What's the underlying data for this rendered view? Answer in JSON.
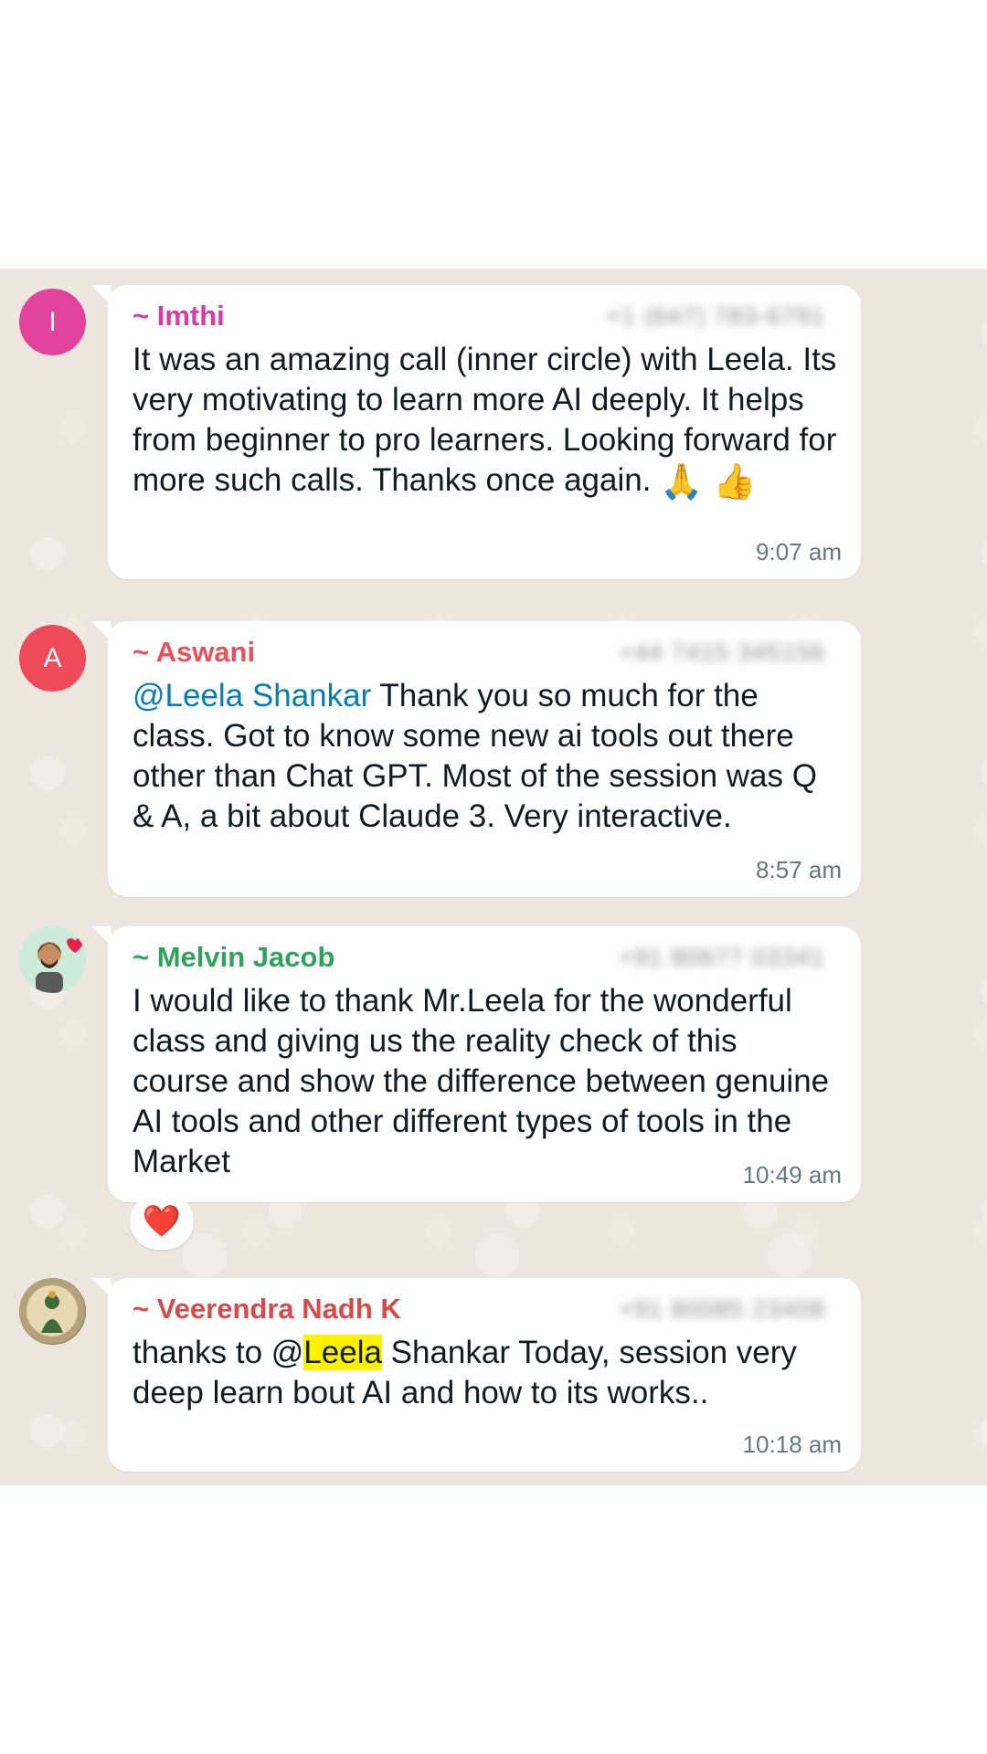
{
  "messages": [
    {
      "avatar_letter": "I",
      "avatar_color": "#e0429c",
      "sender": "~ Imthi",
      "sender_color": "#d63aa6",
      "phone": "+1 (647) 783-6791",
      "text": "It was an amazing call (inner circle) with Leela. Its very motivating to learn more AI deeply. It helps from beginner to pro learners. Looking forward for more such calls. Thanks once again.",
      "emojis": "🙏 👍",
      "time": "9:07 am"
    },
    {
      "avatar_letter": "A",
      "avatar_color": "#ef4a5a",
      "sender": "~ Aswani",
      "sender_color": "#e8505b",
      "phone": "+44 7415 345156",
      "mention": "@Leela Shankar",
      "text": " Thank you so much for the class. Got to know some new ai tools out there other than Chat GPT. Most of the session was Q & A, a bit about Claude 3. Very interactive.",
      "time": "8:57 am"
    },
    {
      "avatar_icon": "memoji-avatar-icon",
      "sender": "~ Melvin Jacob",
      "sender_color": "#2fa35b",
      "phone": "+91 80677 03341",
      "text": "I would like to thank Mr.Leela for the wonderful class and giving us the reality check of this course and show the difference between genuine AI tools and other different types of tools in the Market",
      "time": "10:49 am",
      "reaction": "❤️"
    },
    {
      "avatar_icon": "deity-portrait-icon",
      "sender": "~ Veerendra Nadh K",
      "sender_color": "#d84a4a",
      "phone": "+91 80085 23408",
      "text_before": "thanks to @",
      "highlight": "Leela",
      "text_after": " Shankar Today, session very deep learn bout AI and how to its works..",
      "time": "10:18 am"
    }
  ]
}
